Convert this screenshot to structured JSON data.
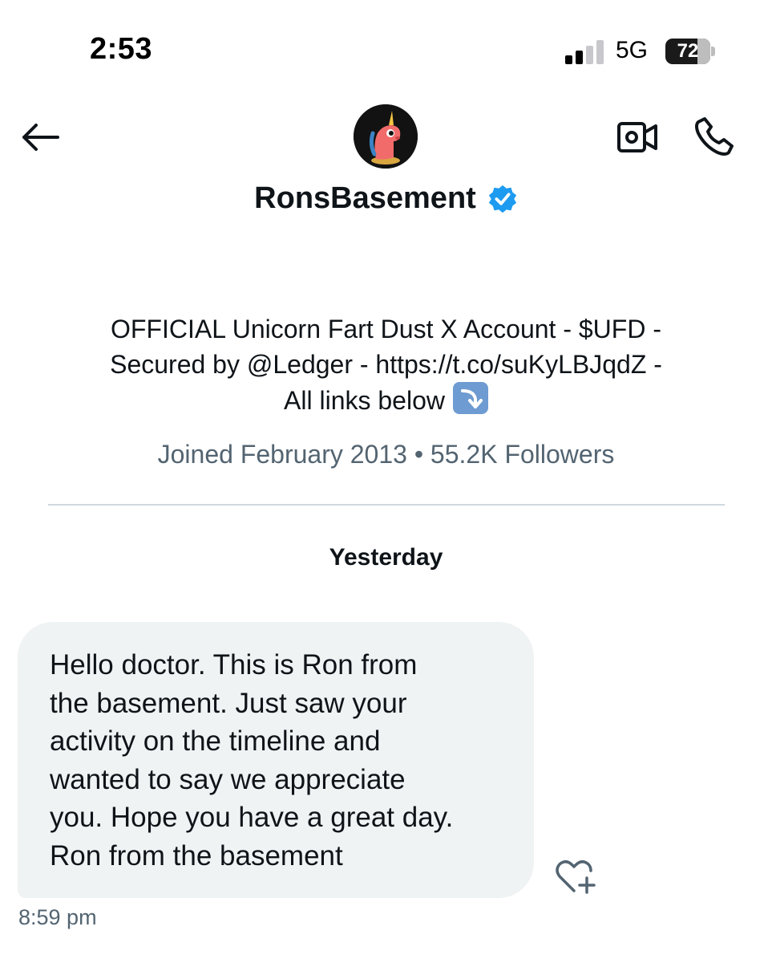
{
  "status_bar": {
    "time": "2:53",
    "network": "5G",
    "battery_percent": "72",
    "battery_level": 0.72,
    "signal_bars_active": 2,
    "signal_bars_total": 4
  },
  "header": {
    "display_name": "RonsBasement",
    "verified": true,
    "verified_color": "#1d9bf0",
    "icons": {
      "back": "arrow-left-icon",
      "video": "video-camera-icon",
      "call": "phone-icon"
    }
  },
  "profile": {
    "bio_lines": [
      "OFFICIAL Unicorn Fart Dust X Account - $UFD -",
      "Secured by @Ledger - https://t.co/suKyLBJqdZ -",
      "All links below"
    ],
    "bio_emoji": "arrow-down-right-emoji",
    "meta": "Joined February 2013 • 55.2K Followers"
  },
  "conversation": {
    "date_separator": "Yesterday",
    "messages": [
      {
        "lines": [
          "Hello doctor. This is Ron from",
          "the basement. Just saw your",
          "activity on the timeline and",
          "wanted to say we appreciate",
          "you. Hope you have a great day.",
          "Ron from the basement"
        ],
        "time": "8:59 pm",
        "react_icon": "heart-plus-icon"
      }
    ]
  },
  "colors": {
    "text_primary": "#0f1419",
    "text_secondary": "#536471",
    "bubble_bg": "#eff3f4",
    "divider": "#cfd9de"
  }
}
